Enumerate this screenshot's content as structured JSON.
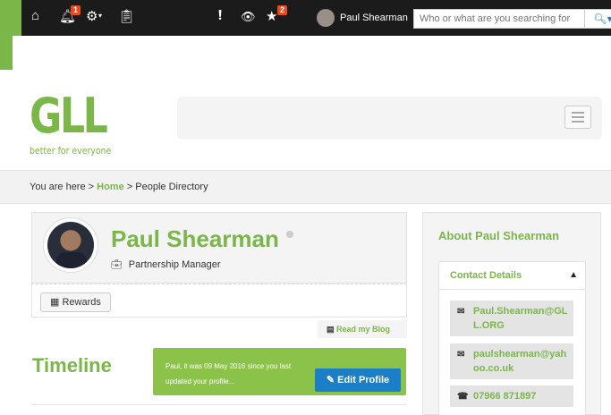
{
  "topbar": {
    "icons": [
      "home-icon",
      "bell-icon",
      "gear-icon",
      "clipboard-icon",
      "alert-icon",
      "eye-icon",
      "star-icon"
    ],
    "notifications_badge": "1",
    "favourites_badge": "2",
    "user_name": "Paul Shearman",
    "search_placeholder": "Who or what are you searching for"
  },
  "header": {
    "logo_text": "GLL",
    "logo_tagline": "better for everyone"
  },
  "breadcrumb": {
    "prefix": "You are here >",
    "home": "Home",
    "sep": ">",
    "current": "People Directory"
  },
  "profile": {
    "name": "Paul Shearman",
    "job_title": "Partnership Manager",
    "rewards_label": "Rewards",
    "blog_label": "Read my Blog"
  },
  "timeline": {
    "title": "Timeline",
    "notice": "Paul, it was 09 May 2016 since you last updated your profile...",
    "edit_label": "Edit Profile"
  },
  "about": {
    "title": "About Paul Shearman",
    "contact_title": "Contact Details",
    "email_work": "Paul.Shearman@GLL.ORG",
    "email_personal": "paulshearman@yahoo.co.uk",
    "phone": "07966 871897"
  },
  "colors": {
    "brand_green": "#7ab648",
    "topbar": "#1b1b1b",
    "button_blue": "#1a7fc7",
    "badge": "#e8491d"
  }
}
